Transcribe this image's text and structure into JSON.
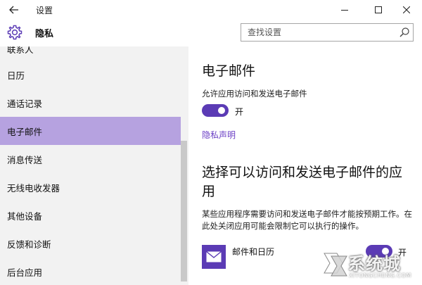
{
  "window": {
    "title": "设置"
  },
  "header": {
    "section_title": "隐私",
    "search_placeholder": "查找设置"
  },
  "sidebar": {
    "items": [
      {
        "label": "联系人"
      },
      {
        "label": "日历"
      },
      {
        "label": "通话记录"
      },
      {
        "label": "电子邮件",
        "selected": true
      },
      {
        "label": "消息传送"
      },
      {
        "label": "无线电收发器"
      },
      {
        "label": "其他设备"
      },
      {
        "label": "反馈和诊断"
      },
      {
        "label": "后台应用"
      }
    ]
  },
  "main": {
    "title": "电子邮件",
    "allow_text": "允许应用访问和发送电子邮件",
    "toggle_label": "开",
    "toggle_on": true,
    "privacy_link": "隐私声明",
    "choose_title": "选择可以访问和发送电子邮件的应用",
    "description": "某些应用程序需要访问和发送电子邮件才能按预期工作。在此处关闭应用可能会限制它可以执行的操作。",
    "apps": [
      {
        "name": "邮件和日历",
        "toggle_label": "开",
        "toggle_on": true
      }
    ]
  },
  "watermark": {
    "text": "系统城",
    "sub": "XITONGCHENG.COM"
  },
  "colors": {
    "accent": "#5b3bb5",
    "selected_bg": "#b6a2e0",
    "sidebar_bg": "#f2f2f2",
    "link": "#6b3fc5"
  }
}
